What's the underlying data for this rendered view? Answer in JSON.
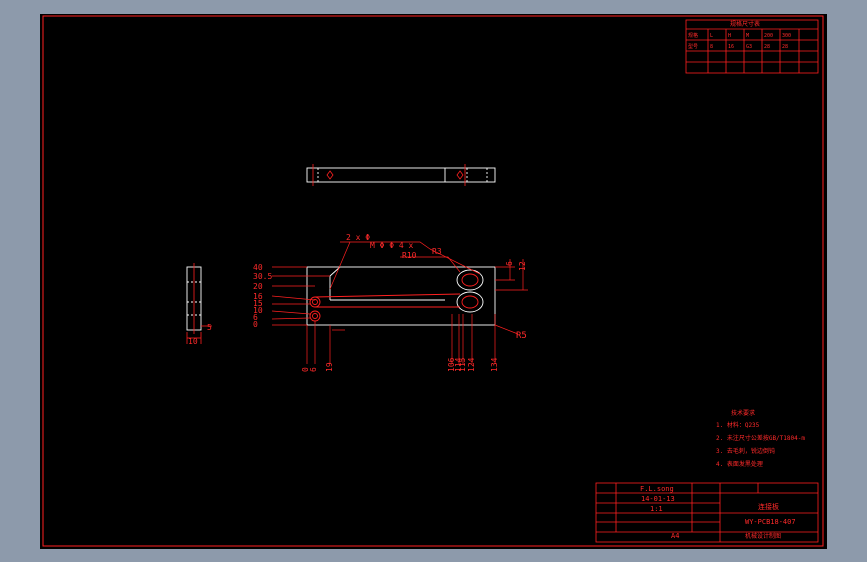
{
  "colors": {
    "background": "#8d9aab",
    "viewport": "#000000",
    "frame": "#ff2020",
    "geometry": "#ffffff",
    "text": "#ff2a2a"
  },
  "table": {
    "title": "规格尺寸表",
    "headers": [
      "规格",
      "L",
      "H",
      "M",
      "200",
      "300"
    ],
    "rows": [
      [
        "",
        "",
        "",
        "",
        "",
        ""
      ],
      [
        "型号",
        "8",
        "16",
        "G3",
        "28",
        "28"
      ],
      [
        "",
        "",
        "",
        "",
        "",
        ""
      ],
      [
        "",
        "",
        "",
        "",
        "",
        ""
      ]
    ]
  },
  "callouts": {
    "top": "2 x Φ",
    "top2": "M  Φ  Φ  4  x",
    "r3": "R3",
    "r10": "R10",
    "r5": "R5",
    "dim5": "5",
    "dim10": "10"
  },
  "left_dims": [
    "40",
    "30.5",
    "20",
    "16",
    "15",
    "10",
    "6",
    "0"
  ],
  "bottom_dims": [
    "0",
    "6",
    "19",
    "106",
    "114",
    "115",
    "124",
    "134"
  ],
  "right_dims": [
    "6",
    "12"
  ],
  "tech_title": "技术要求",
  "tech_notes": [
    "1. 材料：Q235",
    "2. 未注尺寸公差按GB/T1804-m",
    "3. 去毛刺，锐边倒钝",
    "4. 表面发黑处理"
  ],
  "titleblock": {
    "designer": "F.L.song",
    "date": "14-01-13",
    "scale": "1:1",
    "part_name": "连接板",
    "drawing_no": "WY-PCB18-407",
    "sheet": "A4",
    "company": "机械设计制图"
  }
}
